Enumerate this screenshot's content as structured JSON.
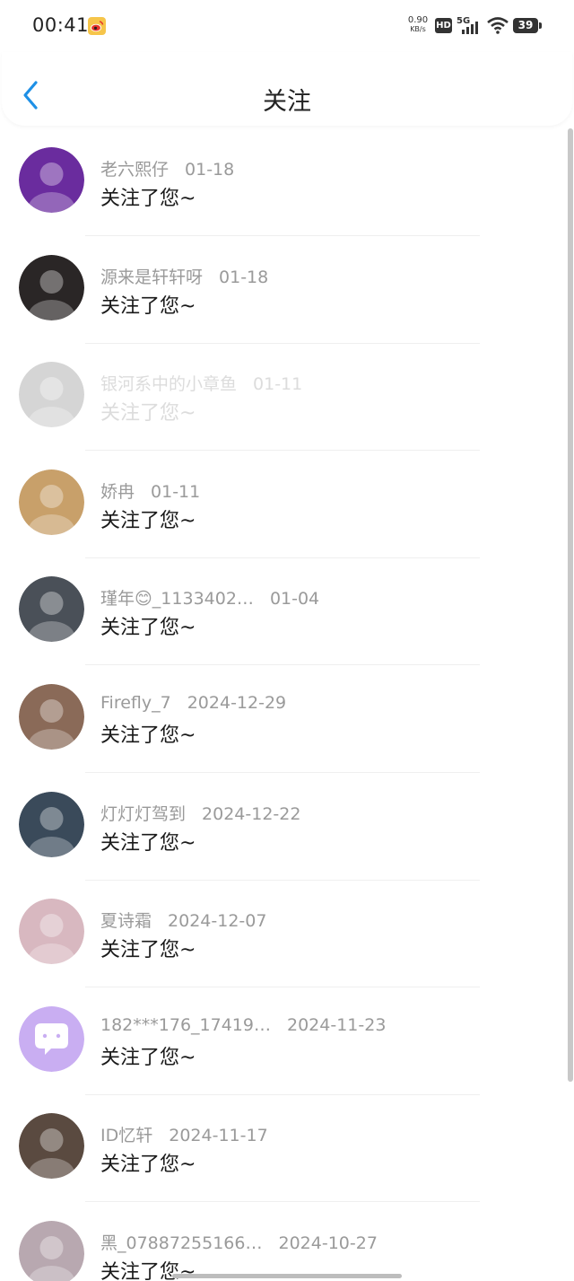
{
  "status_bar": {
    "time": "00:41",
    "net_speed_value": "0.90",
    "net_speed_unit": "KB/s",
    "hd": "HD",
    "network": "5G",
    "battery": "39"
  },
  "header": {
    "title": "关注"
  },
  "notifications": [
    {
      "username": "老六熙仔",
      "date": "01-18",
      "action": "关注了您~",
      "avatar_color": "#6a2c9e",
      "faded": false
    },
    {
      "username": "源来是轩轩呀",
      "date": "01-18",
      "action": "关注了您~",
      "avatar_color": "#2a2626",
      "faded": false
    },
    {
      "username": "银河系中的小章鱼",
      "date": "01-11",
      "action": "关注了您~",
      "avatar_color": "#8a8a8a",
      "faded": true
    },
    {
      "username": "娇冉",
      "date": "01-11",
      "action": "关注了您~",
      "avatar_color": "#c8a06a",
      "faded": false
    },
    {
      "username": "瑾年😊_1133402…",
      "date": "01-04",
      "action": "关注了您~",
      "avatar_color": "#4a5058",
      "faded": false
    },
    {
      "username": "Firefly_7",
      "date": "2024-12-29",
      "action": "关注了您~",
      "avatar_color": "#8a6a58",
      "faded": false
    },
    {
      "username": "灯灯灯驾到",
      "date": "2024-12-22",
      "action": "关注了您~",
      "avatar_color": "#3a4a5a",
      "faded": false
    },
    {
      "username": "夏诗霜",
      "date": "2024-12-07",
      "action": "关注了您~",
      "avatar_color": "#d8b8c0",
      "faded": false
    },
    {
      "username": "182***176_17419…",
      "date": "2024-11-23",
      "action": "关注了您~",
      "avatar_color": "#c9aef2",
      "faded": false
    },
    {
      "username": "ID忆轩",
      "date": "2024-11-17",
      "action": "关注了您~",
      "avatar_color": "#5a4a40",
      "faded": false
    },
    {
      "username": "黑_07887255166…",
      "date": "2024-10-27",
      "action": "关注了您~",
      "avatar_color": "#b8a8b0",
      "faded": false
    }
  ],
  "colors": {
    "accent": "#1e90e6",
    "text_primary": "#1a1a1a",
    "text_secondary": "#9a9a9a"
  }
}
